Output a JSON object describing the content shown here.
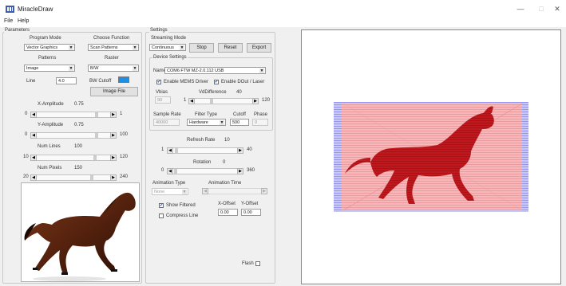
{
  "window": {
    "title": "MiracleDraw",
    "minimize": "—",
    "maximize": "□",
    "close": "✕"
  },
  "menu": {
    "file": "File",
    "help": "Help"
  },
  "parameters": {
    "group_label": "Parameters",
    "program_mode_label": "Program Mode",
    "program_mode_value": "Vector Graphics",
    "choose_function_label": "Choose Function",
    "choose_function_value": "Scan Patterns",
    "patterns_label": "Patterns",
    "patterns_value": "Image",
    "raster_label": "Raster",
    "raster_value": "B/W",
    "line_label": "Line",
    "line_value": "4.0",
    "bw_cutoff_label": "BW Cutoff",
    "image_file_button": "Image File",
    "x_amplitude_label": "X-Amplitude",
    "x_amplitude_value": "0.75",
    "x_amp_min": "0",
    "x_amp_max": "1",
    "y_amplitude_label": "Y-Amplitude",
    "y_amplitude_value": "0.75",
    "y_amp_min": "0",
    "y_amp_max": "100",
    "num_lines_label": "Num Lines",
    "num_lines_value": "100",
    "num_lines_min": "10",
    "num_lines_max": "120",
    "num_pixels_label": "Num Pixels",
    "num_pixels_value": "150",
    "num_pixels_min": "20",
    "num_pixels_max": "240"
  },
  "settings": {
    "group_label": "Settings",
    "streaming_mode_label": "Streaming Mode",
    "streaming_mode_value": "Continuous",
    "stop_button": "Stop",
    "reset_button": "Reset",
    "export_button": "Export",
    "device_settings_label": "Device Settings",
    "name_label": "Name",
    "name_value": "COM6 FTW MZ-2.0.112 USB",
    "enable_mems_label": "Enable MEMS Driver",
    "enable_dout_label": "Enable DOut / Laser",
    "vbias_label": "Vbias",
    "vbias_value": "90",
    "vdifference_label": "VdDifference",
    "vdifference_value": "40",
    "vdiff_min": "1",
    "vdiff_max": "120",
    "sample_rate_label": "Sample Rate",
    "sample_rate_value": "40000",
    "filter_type_label": "Filter Type",
    "filter_type_value": "Hardware",
    "cutoff_label": "Cutoff",
    "cutoff_value": "500",
    "phase_label": "Phase",
    "phase_value": "0",
    "refresh_rate_label": "Refresh Rate",
    "refresh_rate_value": "10",
    "refresh_min": "1",
    "refresh_max": "40",
    "rotation_label": "Rotation",
    "rotation_value": "0",
    "rotation_min": "0",
    "rotation_max": "360",
    "animation_type_label": "Animation Type",
    "animation_type_value": "None",
    "animation_time_label": "Animation Time",
    "show_filtered_label": "Show Filtered",
    "compress_line_label": "Compress Line",
    "x_offset_label": "X-Offset",
    "x_offset_value": "0.00",
    "y_offset_label": "Y-Offset",
    "y_offset_value": "0.00",
    "flash_label": "Flash"
  },
  "colors": {
    "bw_cutoff_swatch": "#1e8fe6",
    "horse_fill": "#c0181d",
    "scan_pink": "#f6b7b9",
    "scan_blue": "#8d8df0"
  }
}
